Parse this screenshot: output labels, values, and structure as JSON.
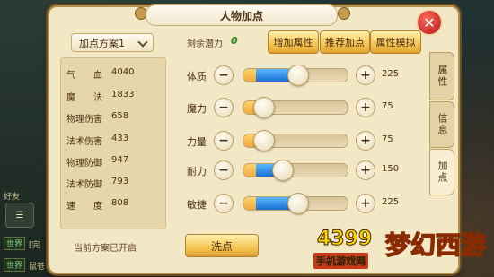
{
  "window": {
    "title": "人物加点"
  },
  "scheme": {
    "selected": "加点方案1",
    "status": "当前方案已开启"
  },
  "stats": [
    {
      "label": "气　　血",
      "value": "4040"
    },
    {
      "label": "魔　　法",
      "value": "1833"
    },
    {
      "label": "物理伤害",
      "value": "658"
    },
    {
      "label": "法术伤害",
      "value": "433"
    },
    {
      "label": "物理防御",
      "value": "947"
    },
    {
      "label": "法术防御",
      "value": "793"
    },
    {
      "label": "速　　度",
      "value": "808"
    }
  ],
  "points": {
    "label": "剩余潜力",
    "value": "0"
  },
  "buttons": {
    "add": "增加属性",
    "recommend": "推荐加点",
    "simulate": "属性模拟",
    "reset": "洗点"
  },
  "attributes": [
    {
      "label": "体质",
      "value": "225",
      "base_fraction": 0.12,
      "added_fraction": 0.33
    },
    {
      "label": "魔力",
      "value": "75",
      "base_fraction": 0.12,
      "added_fraction": 0.0
    },
    {
      "label": "力量",
      "value": "75",
      "base_fraction": 0.12,
      "added_fraction": 0.0
    },
    {
      "label": "耐力",
      "value": "150",
      "base_fraction": 0.12,
      "added_fraction": 0.18
    },
    {
      "label": "敏捷",
      "value": "225",
      "base_fraction": 0.12,
      "added_fraction": 0.33
    }
  ],
  "tabs": [
    {
      "label": "属性",
      "active": false
    },
    {
      "label": "信息",
      "active": false
    },
    {
      "label": "加点",
      "active": true
    }
  ],
  "background": {
    "side_labels": {
      "friends": "好友",
      "world1": "世界",
      "world1_text": "[完",
      "world2": "世界",
      "world2_text": "鼠苍"
    }
  },
  "watermark": {
    "number": "4399",
    "subtitle": "手机游戏网",
    "game": "梦幻西游"
  },
  "colors": {
    "accent": "#f4c451",
    "panel": "#f3e8c6",
    "bar_added": "#1b6fd1",
    "bar_base": "#f0a93a",
    "points": "#2a8a1f"
  }
}
